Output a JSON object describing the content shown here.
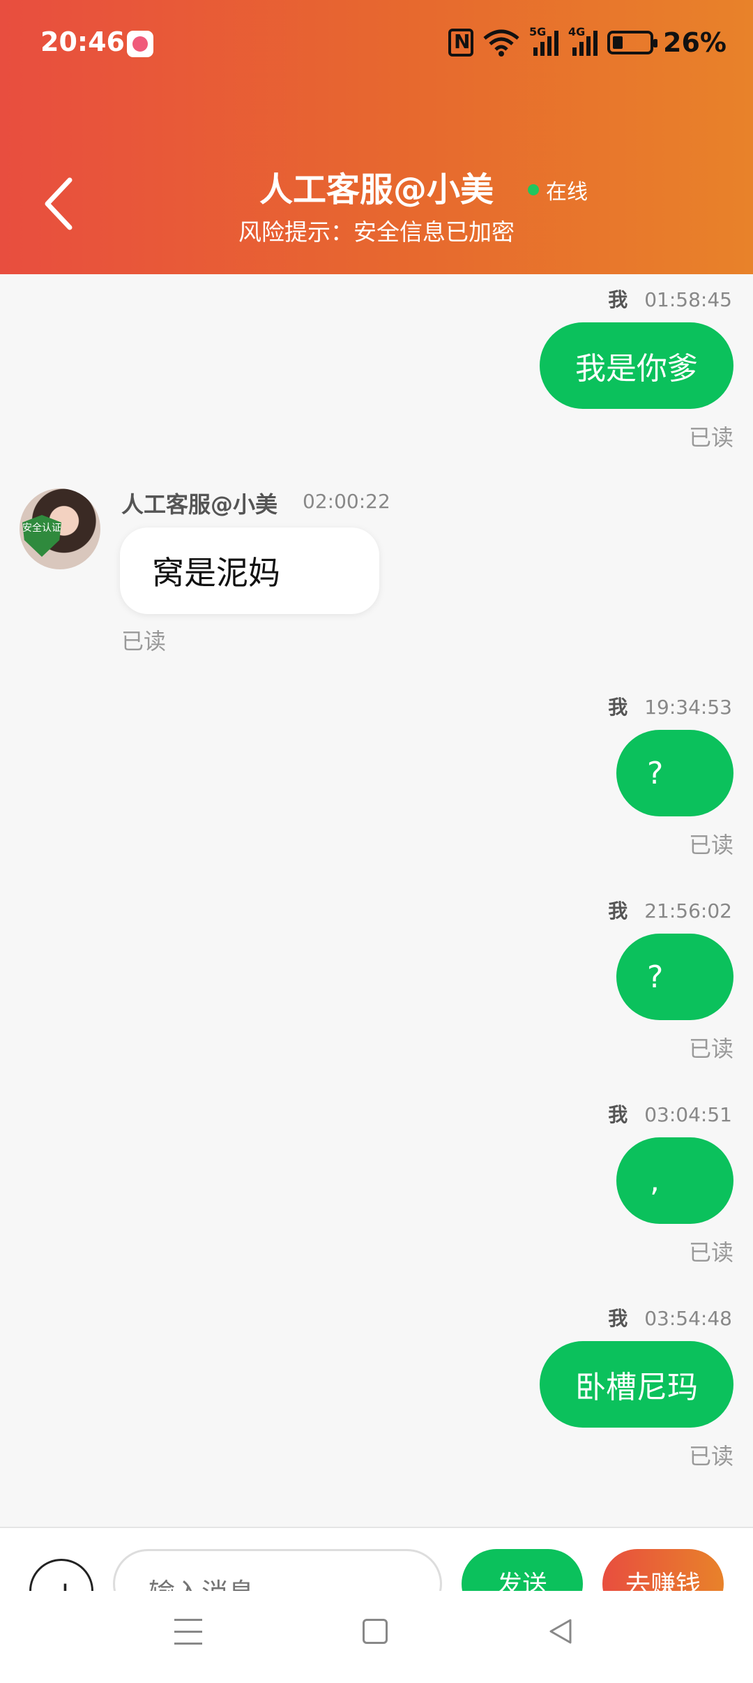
{
  "status_bar": {
    "time": "20:46",
    "battery": "26%",
    "signal_1": "5G",
    "signal_2": "4G"
  },
  "header": {
    "title": "人工客服@小美",
    "status": "在线",
    "subtitle": "风险提示：安全信息已加密"
  },
  "messages": [
    {
      "side": "right",
      "sender": "我",
      "time": "01:58:45",
      "text": "我是你爹",
      "read": "已读"
    },
    {
      "side": "left",
      "sender": "人工客服@小美",
      "time": "02:00:22",
      "text": "窝是泥妈",
      "read": "已读",
      "badge": "安全认证"
    },
    {
      "side": "right",
      "sender": "我",
      "time": "19:34:53",
      "text": "?",
      "read": "已读"
    },
    {
      "side": "right",
      "sender": "我",
      "time": "21:56:02",
      "text": "?",
      "read": "已读"
    },
    {
      "side": "right",
      "sender": "我",
      "time": "03:04:51",
      "text": ",",
      "read": "已读"
    },
    {
      "side": "right",
      "sender": "我",
      "time": "03:54:48",
      "text": "卧槽尼玛",
      "read": "已读"
    }
  ],
  "input_bar": {
    "placeholder": "输入消息",
    "send_label": "发送",
    "earn_label": "去赚钱"
  },
  "colors": {
    "accent": "#0bc15c",
    "header_start": "#e84e3f",
    "header_end": "#e8822a"
  }
}
